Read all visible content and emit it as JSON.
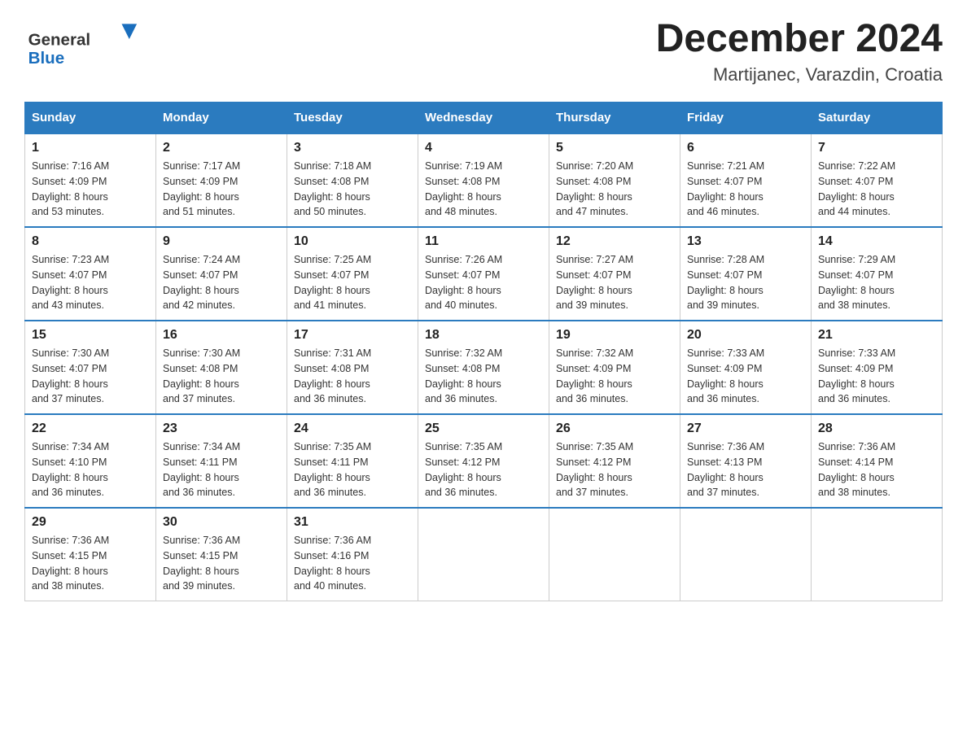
{
  "header": {
    "logo_general": "General",
    "logo_blue": "Blue",
    "month_title": "December 2024",
    "location": "Martijanec, Varazdin, Croatia"
  },
  "days_of_week": [
    "Sunday",
    "Monday",
    "Tuesday",
    "Wednesday",
    "Thursday",
    "Friday",
    "Saturday"
  ],
  "weeks": [
    [
      {
        "day": "1",
        "sunrise": "7:16 AM",
        "sunset": "4:09 PM",
        "daylight": "8 hours and 53 minutes."
      },
      {
        "day": "2",
        "sunrise": "7:17 AM",
        "sunset": "4:09 PM",
        "daylight": "8 hours and 51 minutes."
      },
      {
        "day": "3",
        "sunrise": "7:18 AM",
        "sunset": "4:08 PM",
        "daylight": "8 hours and 50 minutes."
      },
      {
        "day": "4",
        "sunrise": "7:19 AM",
        "sunset": "4:08 PM",
        "daylight": "8 hours and 48 minutes."
      },
      {
        "day": "5",
        "sunrise": "7:20 AM",
        "sunset": "4:08 PM",
        "daylight": "8 hours and 47 minutes."
      },
      {
        "day": "6",
        "sunrise": "7:21 AM",
        "sunset": "4:07 PM",
        "daylight": "8 hours and 46 minutes."
      },
      {
        "day": "7",
        "sunrise": "7:22 AM",
        "sunset": "4:07 PM",
        "daylight": "8 hours and 44 minutes."
      }
    ],
    [
      {
        "day": "8",
        "sunrise": "7:23 AM",
        "sunset": "4:07 PM",
        "daylight": "8 hours and 43 minutes."
      },
      {
        "day": "9",
        "sunrise": "7:24 AM",
        "sunset": "4:07 PM",
        "daylight": "8 hours and 42 minutes."
      },
      {
        "day": "10",
        "sunrise": "7:25 AM",
        "sunset": "4:07 PM",
        "daylight": "8 hours and 41 minutes."
      },
      {
        "day": "11",
        "sunrise": "7:26 AM",
        "sunset": "4:07 PM",
        "daylight": "8 hours and 40 minutes."
      },
      {
        "day": "12",
        "sunrise": "7:27 AM",
        "sunset": "4:07 PM",
        "daylight": "8 hours and 39 minutes."
      },
      {
        "day": "13",
        "sunrise": "7:28 AM",
        "sunset": "4:07 PM",
        "daylight": "8 hours and 39 minutes."
      },
      {
        "day": "14",
        "sunrise": "7:29 AM",
        "sunset": "4:07 PM",
        "daylight": "8 hours and 38 minutes."
      }
    ],
    [
      {
        "day": "15",
        "sunrise": "7:30 AM",
        "sunset": "4:07 PM",
        "daylight": "8 hours and 37 minutes."
      },
      {
        "day": "16",
        "sunrise": "7:30 AM",
        "sunset": "4:08 PM",
        "daylight": "8 hours and 37 minutes."
      },
      {
        "day": "17",
        "sunrise": "7:31 AM",
        "sunset": "4:08 PM",
        "daylight": "8 hours and 36 minutes."
      },
      {
        "day": "18",
        "sunrise": "7:32 AM",
        "sunset": "4:08 PM",
        "daylight": "8 hours and 36 minutes."
      },
      {
        "day": "19",
        "sunrise": "7:32 AM",
        "sunset": "4:09 PM",
        "daylight": "8 hours and 36 minutes."
      },
      {
        "day": "20",
        "sunrise": "7:33 AM",
        "sunset": "4:09 PM",
        "daylight": "8 hours and 36 minutes."
      },
      {
        "day": "21",
        "sunrise": "7:33 AM",
        "sunset": "4:09 PM",
        "daylight": "8 hours and 36 minutes."
      }
    ],
    [
      {
        "day": "22",
        "sunrise": "7:34 AM",
        "sunset": "4:10 PM",
        "daylight": "8 hours and 36 minutes."
      },
      {
        "day": "23",
        "sunrise": "7:34 AM",
        "sunset": "4:11 PM",
        "daylight": "8 hours and 36 minutes."
      },
      {
        "day": "24",
        "sunrise": "7:35 AM",
        "sunset": "4:11 PM",
        "daylight": "8 hours and 36 minutes."
      },
      {
        "day": "25",
        "sunrise": "7:35 AM",
        "sunset": "4:12 PM",
        "daylight": "8 hours and 36 minutes."
      },
      {
        "day": "26",
        "sunrise": "7:35 AM",
        "sunset": "4:12 PM",
        "daylight": "8 hours and 37 minutes."
      },
      {
        "day": "27",
        "sunrise": "7:36 AM",
        "sunset": "4:13 PM",
        "daylight": "8 hours and 37 minutes."
      },
      {
        "day": "28",
        "sunrise": "7:36 AM",
        "sunset": "4:14 PM",
        "daylight": "8 hours and 38 minutes."
      }
    ],
    [
      {
        "day": "29",
        "sunrise": "7:36 AM",
        "sunset": "4:15 PM",
        "daylight": "8 hours and 38 minutes."
      },
      {
        "day": "30",
        "sunrise": "7:36 AM",
        "sunset": "4:15 PM",
        "daylight": "8 hours and 39 minutes."
      },
      {
        "day": "31",
        "sunrise": "7:36 AM",
        "sunset": "4:16 PM",
        "daylight": "8 hours and 40 minutes."
      },
      null,
      null,
      null,
      null
    ]
  ],
  "labels": {
    "sunrise": "Sunrise:",
    "sunset": "Sunset:",
    "daylight": "Daylight:"
  }
}
